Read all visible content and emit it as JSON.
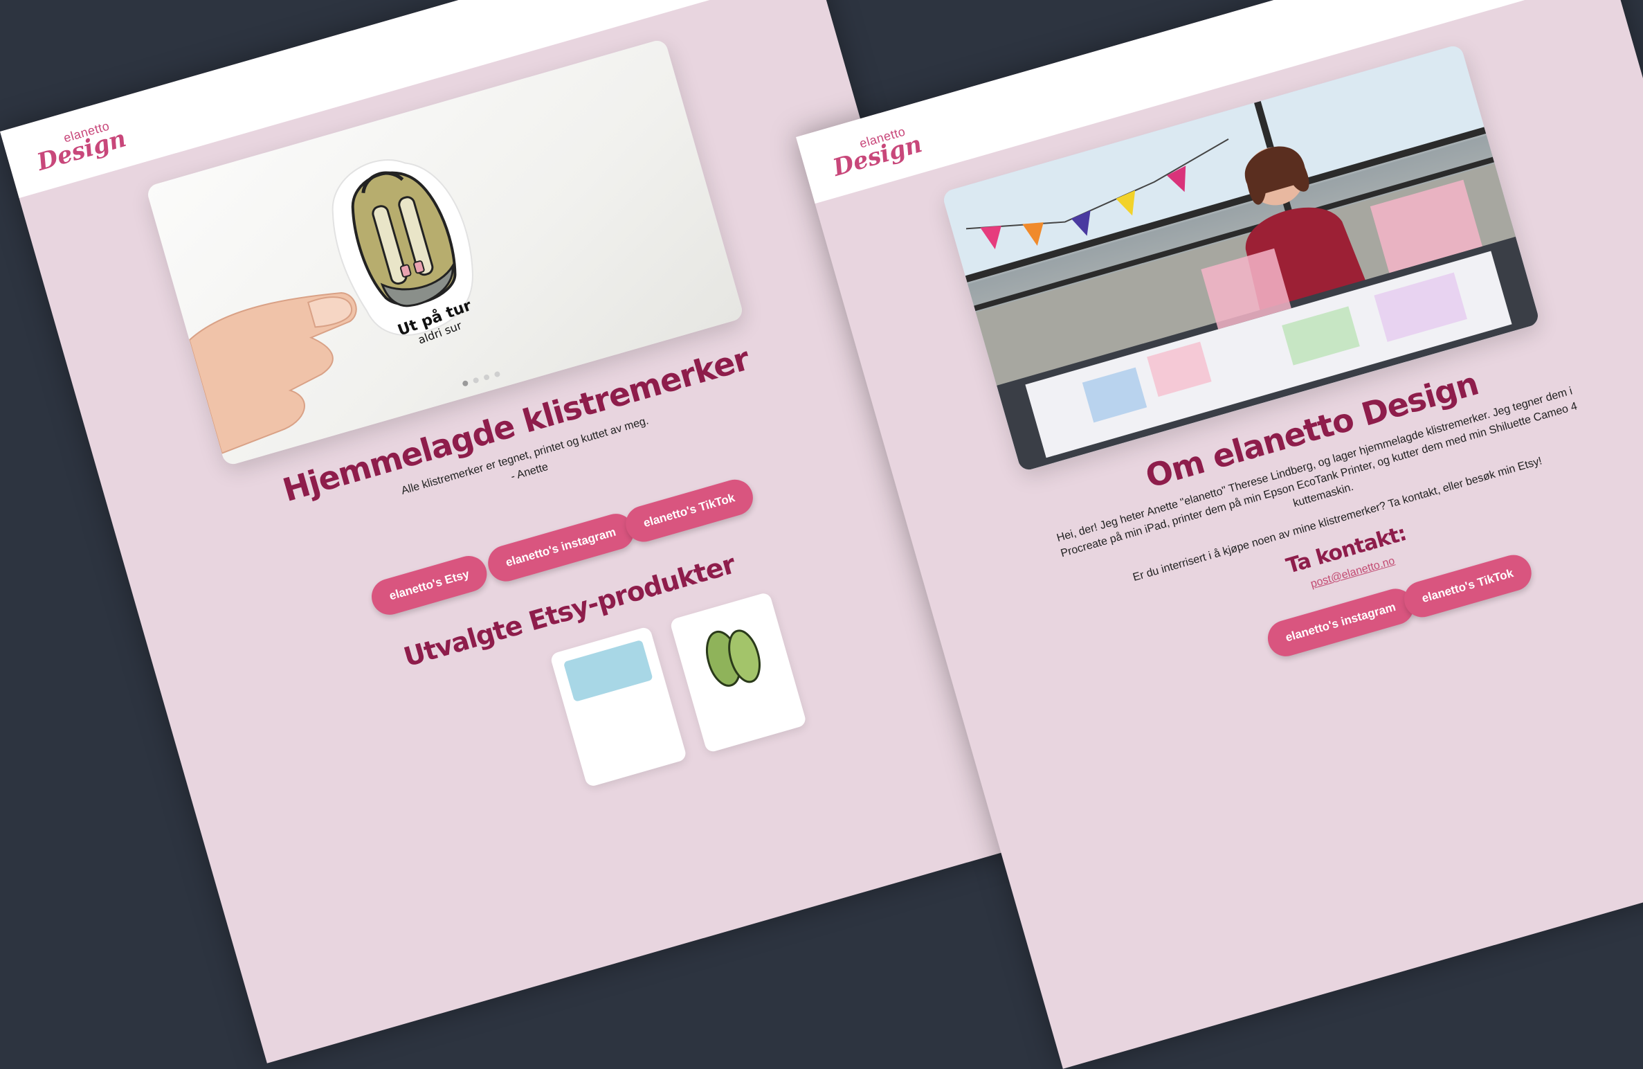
{
  "logo": {
    "small": "elanetto",
    "big": "Design"
  },
  "home": {
    "heading": "Hjemmelagde klistremerker",
    "text": "Alle klistremerker er tegnet, printet og kuttet av meg.",
    "signature": "- Anette",
    "buttons": {
      "etsy": "elanetto's Etsy",
      "instagram": "elanetto's instagram",
      "tiktok": "elanetto's TikTok"
    },
    "products_heading": "Utvalgte Etsy-produkter",
    "sticker_caption": {
      "line1": "Ut på tur",
      "line2": "aldri sur"
    }
  },
  "about": {
    "heading": "Om elanetto Design",
    "text1": "Hei, der! Jeg heter Anette \"elanetto\" Therese Lindberg, og lager hjemmelagde klistremerker. Jeg tegner dem i Procreate på min iPad, printer dem på min Epson EcoTank Printer, og kutter dem med min Shiluette Cameo 4 kuttemaskin.",
    "text2": "Er du interrisert i å kjøpe noen av mine klistremerker? Ta kontakt, eller besøk min Etsy!",
    "contact_heading": "Ta kontakt:",
    "email": "post@elanetto.no",
    "buttons": {
      "instagram": "elanetto's instagram",
      "tiktok": "elanetto's TikTok"
    }
  },
  "colors": {
    "background": "#2d3440",
    "page": "#e8d5df",
    "accent": "#d9557f",
    "heading": "#8e1d4b"
  }
}
